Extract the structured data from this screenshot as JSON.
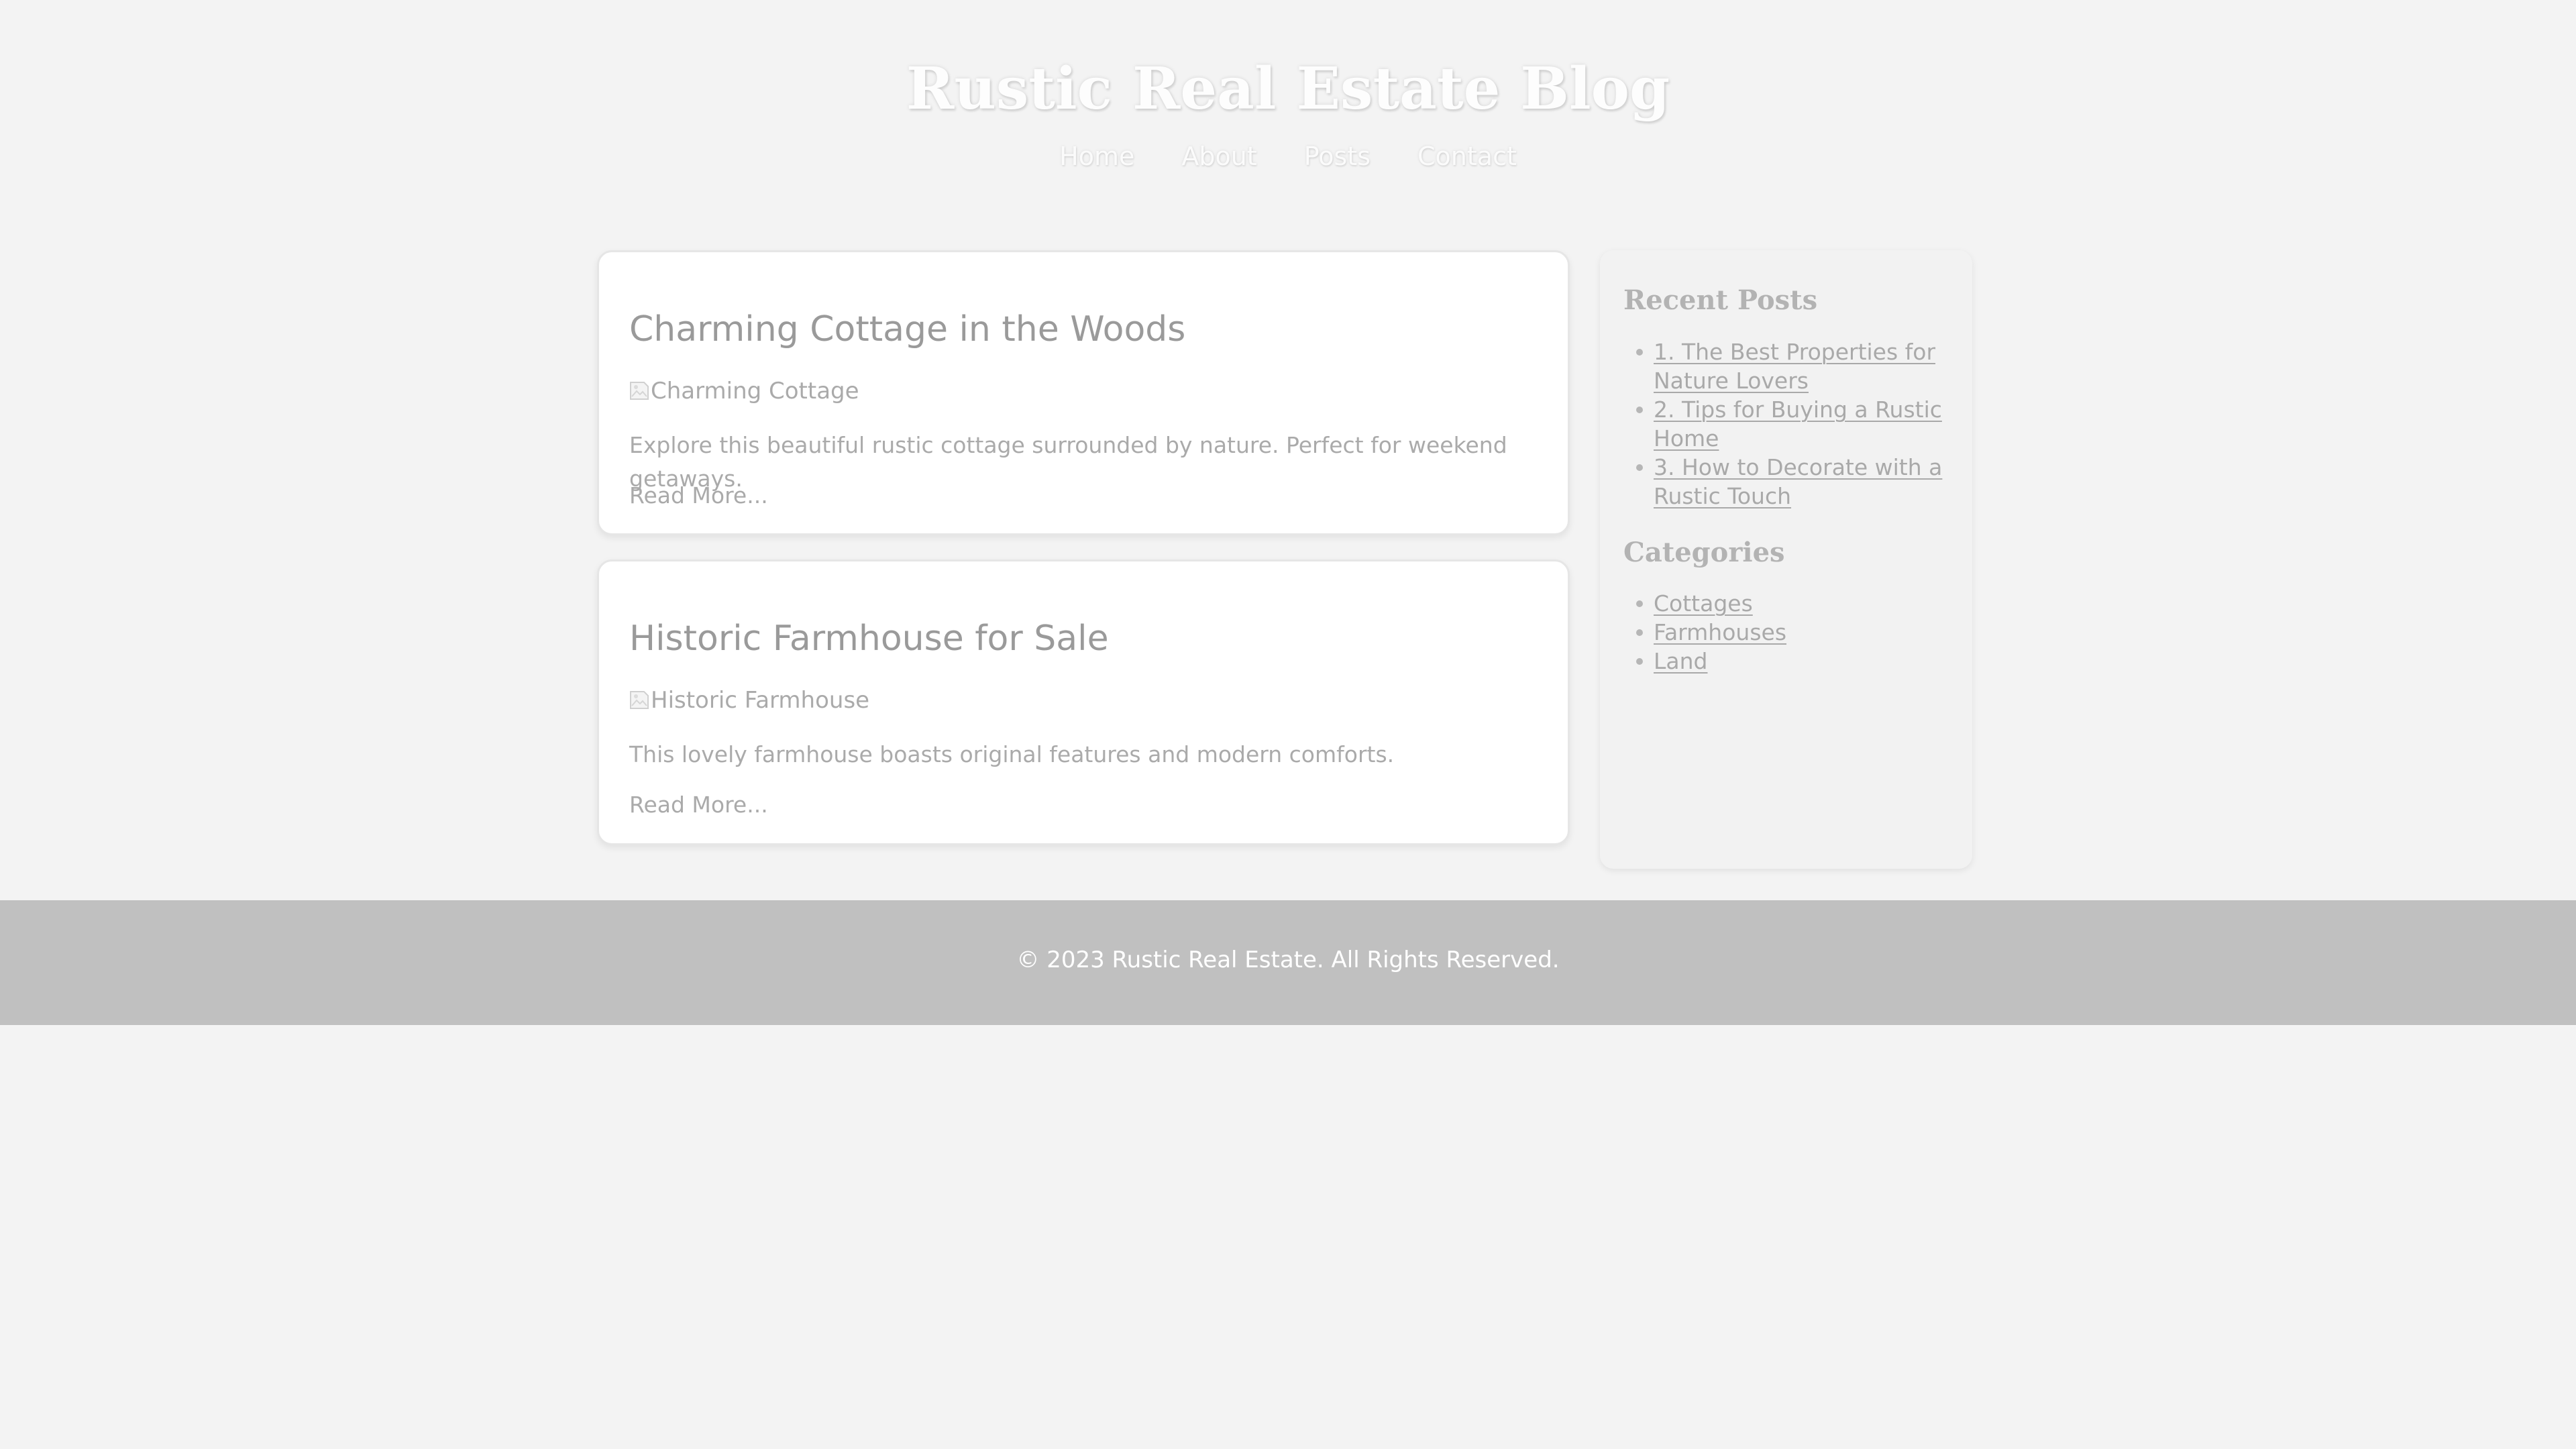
{
  "site": {
    "title": "Rustic Real Estate Blog"
  },
  "nav": {
    "items": [
      "Home",
      "About",
      "Posts",
      "Contact"
    ]
  },
  "posts": [
    {
      "title": "Charming Cottage in the Woods",
      "image_alt": "Charming Cottage",
      "excerpt": "Explore this beautiful rustic cottage surrounded by nature. Perfect for weekend getaways.",
      "read_more": "Read More..."
    },
    {
      "title": "Historic Farmhouse for Sale",
      "image_alt": "Historic Farmhouse",
      "excerpt": "This lovely farmhouse boasts original features and modern comforts.",
      "read_more": "Read More..."
    }
  ],
  "sidebar": {
    "recent_heading": "Recent Posts",
    "recent_posts": [
      "1. The Best Properties for Nature Lovers",
      "2. Tips for Buying a Rustic Home",
      "3. How to Decorate with a Rustic Touch"
    ],
    "categories_heading": "Categories",
    "categories": [
      "Cottages",
      "Farmhouses",
      "Land"
    ]
  },
  "footer": {
    "text": "© 2023 Rustic Real Estate. All Rights Reserved."
  },
  "colors": {
    "page_background": "#f3f3f3",
    "footer_background": "#c0c0c0",
    "card_background": "#ffffff",
    "sidebar_background": "#f2f2f2",
    "muted_text": "#aaaaaa"
  }
}
